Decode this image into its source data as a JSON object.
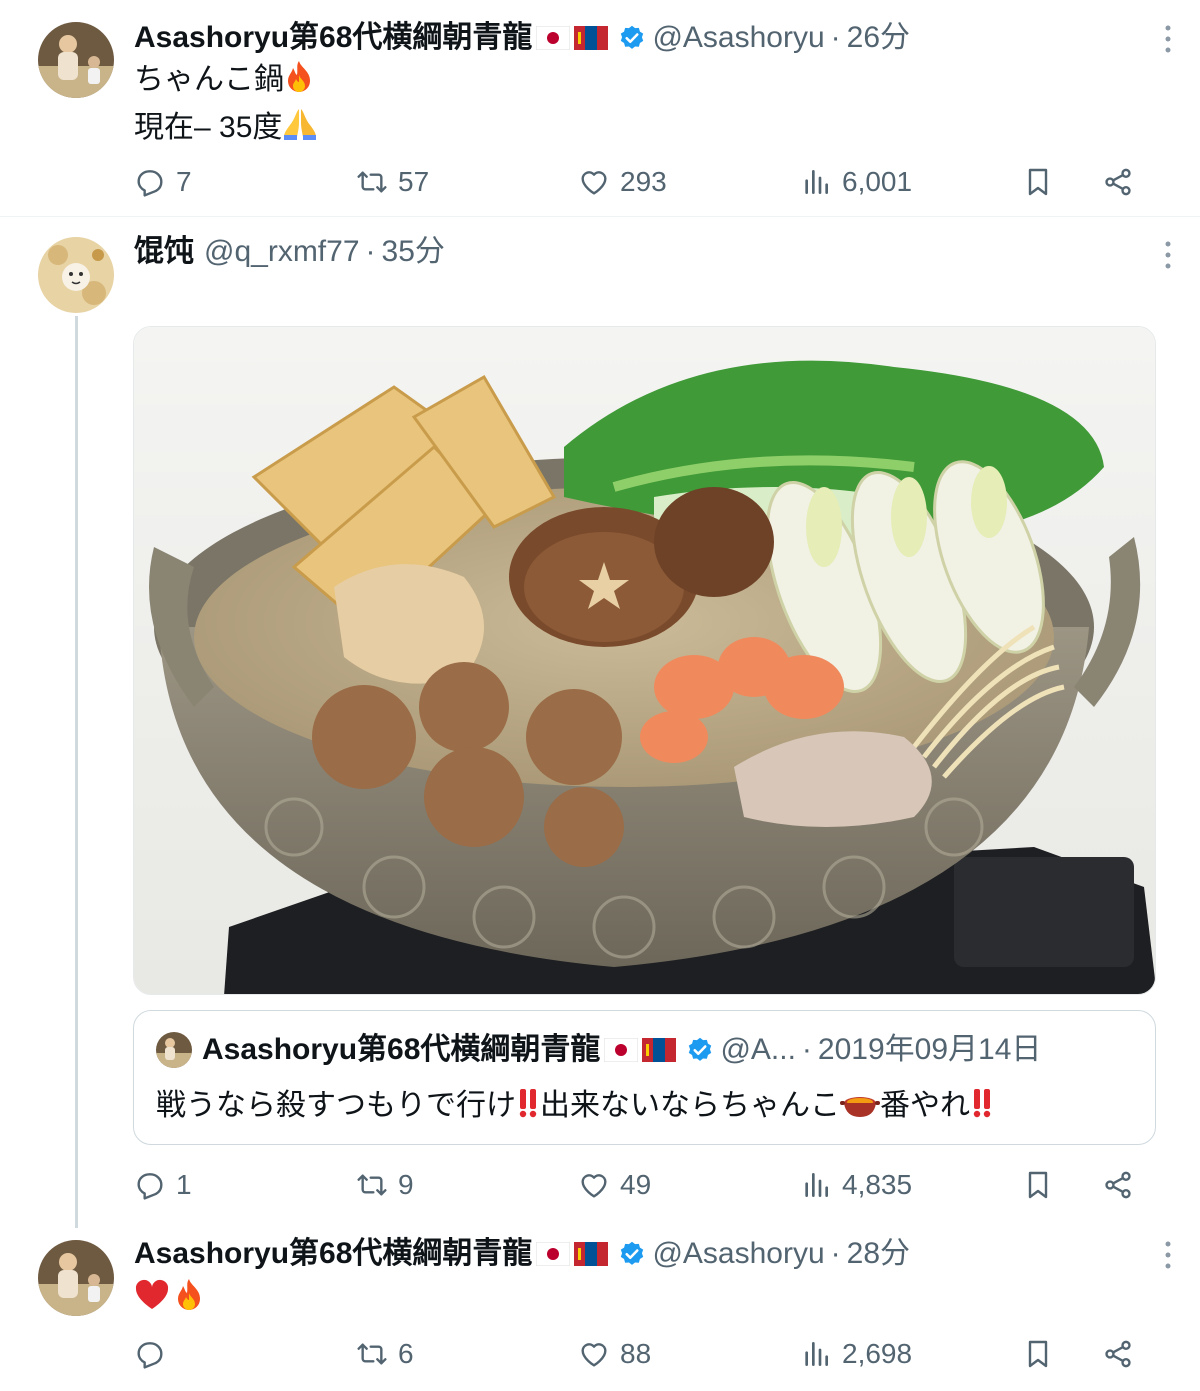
{
  "tweets": [
    {
      "name": "Asashoryu第68代横綱朝青龍",
      "handle": "@Asashoryu",
      "time": "26分",
      "lines": [
        "ちゃんこ鍋",
        "現在– 35度"
      ],
      "stats": {
        "replies": "7",
        "retweets": "57",
        "likes": "293",
        "views": "6,001"
      }
    },
    {
      "name": "馄饨",
      "handle": "@q_rxmf77",
      "time": "35分",
      "stats": {
        "replies": "1",
        "retweets": "9",
        "likes": "49",
        "views": "4,835"
      },
      "quote": {
        "name": "Asashoryu第68代横綱朝青龍",
        "handle": "@A...",
        "date": "2019年09月14日",
        "text_part1": "戦うなら殺すつもりで行け",
        "text_part2": "出来ないならちゃんこ",
        "text_part3": "番やれ"
      }
    },
    {
      "name": "Asashoryu第68代横綱朝青龍",
      "handle": "@Asashoryu",
      "time": "28分",
      "stats": {
        "replies": "",
        "retweets": "6",
        "likes": "88",
        "views": "2,698"
      }
    }
  ],
  "separator": "·",
  "icons": {
    "reply": "reply-icon",
    "retweet": "retweet-icon",
    "like": "heart-icon",
    "views": "views-icon",
    "bookmark": "bookmark-icon",
    "share": "share-icon",
    "verified": "verified-badge-icon",
    "more": "more-options-icon"
  },
  "colors": {
    "text": "#0f1419",
    "secondary": "#536471",
    "verified": "#1d9bf0",
    "divider": "#eff3f4"
  }
}
